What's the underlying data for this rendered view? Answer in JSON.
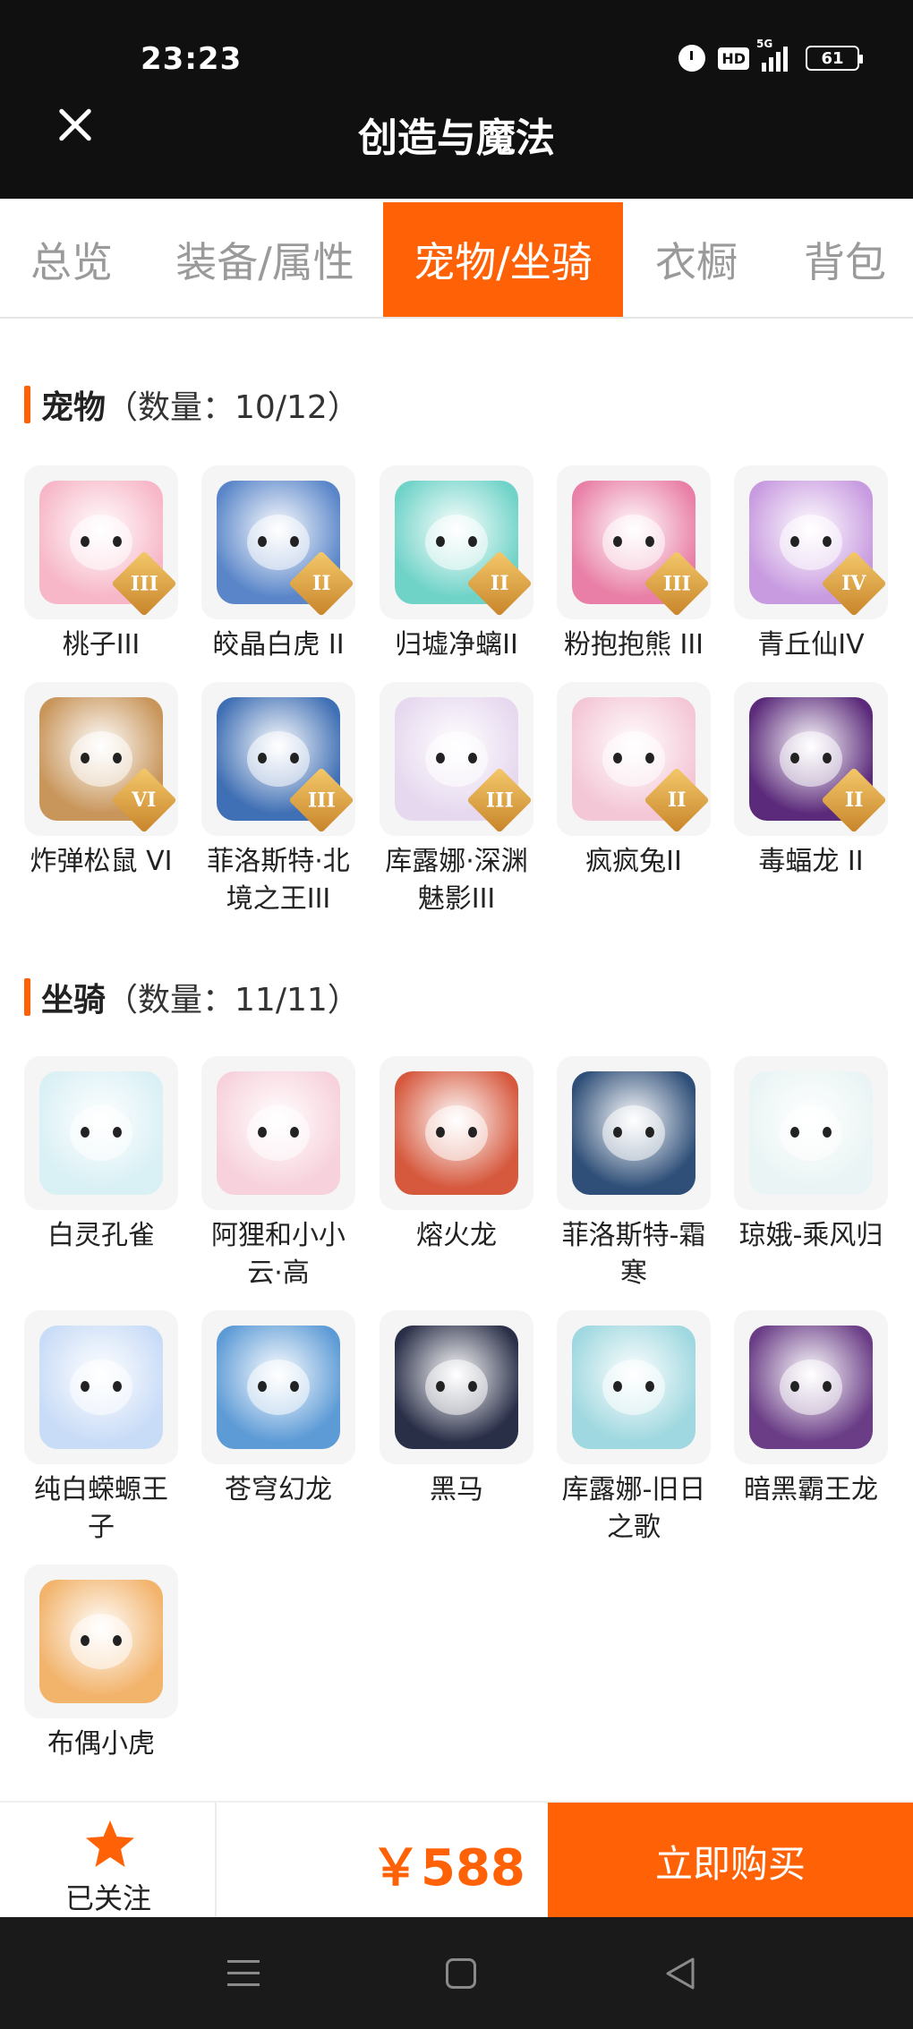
{
  "status_bar": {
    "time": "23:23",
    "hd": "HD",
    "network": "5G",
    "battery": "61"
  },
  "header": {
    "title": "创造与魔法"
  },
  "tabs": [
    {
      "label": "总览",
      "active": false
    },
    {
      "label": "装备/属性",
      "active": false
    },
    {
      "label": "宠物/坐骑",
      "active": true
    },
    {
      "label": "衣橱",
      "active": false
    },
    {
      "label": "背包",
      "active": false
    }
  ],
  "pets": {
    "title": "宠物",
    "count": "（数量：10/12）",
    "items": [
      {
        "name": "桃子III",
        "rank": "III",
        "color": "#f7b7c8",
        "icon": "pink-cat-pet"
      },
      {
        "name": "皎晶白虎 II",
        "rank": "II",
        "color": "#5a86c9",
        "icon": "white-tiger-pet"
      },
      {
        "name": "归墟净螭II",
        "rank": "II",
        "color": "#6fd3c8",
        "icon": "dragon-pet"
      },
      {
        "name": "粉抱抱熊 III",
        "rank": "III",
        "color": "#e97fa6",
        "icon": "pink-bear-pet"
      },
      {
        "name": "青丘仙IV",
        "rank": "IV",
        "color": "#c89be0",
        "icon": "fox-fairy-pet"
      },
      {
        "name": "炸弹松鼠 VI",
        "rank": "VI",
        "color": "#c8955a",
        "icon": "squirrel-pet"
      },
      {
        "name": "菲洛斯特·北境之王III",
        "rank": "III",
        "color": "#3f6fb4",
        "icon": "frost-king-pet"
      },
      {
        "name": "库露娜·深渊魅影III",
        "rank": "III",
        "color": "#e6d8ef",
        "icon": "kuluna-pet"
      },
      {
        "name": "疯疯兔II",
        "rank": "II",
        "color": "#f4c7d6",
        "icon": "rabbit-pet"
      },
      {
        "name": "毒蝠龙 II",
        "rank": "II",
        "color": "#5b2a7a",
        "icon": "bat-dragon-pet"
      }
    ]
  },
  "mounts": {
    "title": "坐骑",
    "count": "（数量：11/11）",
    "items": [
      {
        "name": "白灵孔雀",
        "color": "#d9f0f5",
        "icon": "white-peacock-mount"
      },
      {
        "name": "阿狸和小小云·高",
        "color": "#f7d2dc",
        "icon": "ali-cloud-mount"
      },
      {
        "name": "熔火龙",
        "color": "#d6593e",
        "icon": "fire-dragon-mount"
      },
      {
        "name": "菲洛斯特-霜寒",
        "color": "#2f4f78",
        "icon": "frost-mount"
      },
      {
        "name": "琼娥-乘风归",
        "color": "#eaf4f4",
        "icon": "moon-fairy-mount"
      },
      {
        "name": "纯白蝾螈王子",
        "color": "#c9dcf7",
        "icon": "axolotl-mount"
      },
      {
        "name": "苍穹幻龙",
        "color": "#5d9bd6",
        "icon": "sky-dragon-mount"
      },
      {
        "name": "黑马",
        "color": "#2a2f48",
        "icon": "black-horse-mount"
      },
      {
        "name": "库露娜-旧日之歌",
        "color": "#9fd8e0",
        "icon": "kuluna-song-mount"
      },
      {
        "name": "暗黑霸王龙",
        "color": "#6a3d86",
        "icon": "dark-trex-mount"
      },
      {
        "name": "布偶小虎",
        "color": "#f2b36b",
        "icon": "doll-tiger-mount"
      }
    ]
  },
  "footer": {
    "follow_label": "已关注",
    "price": "￥588",
    "buy_label": "立即购买",
    "accent": "#ff6206"
  }
}
